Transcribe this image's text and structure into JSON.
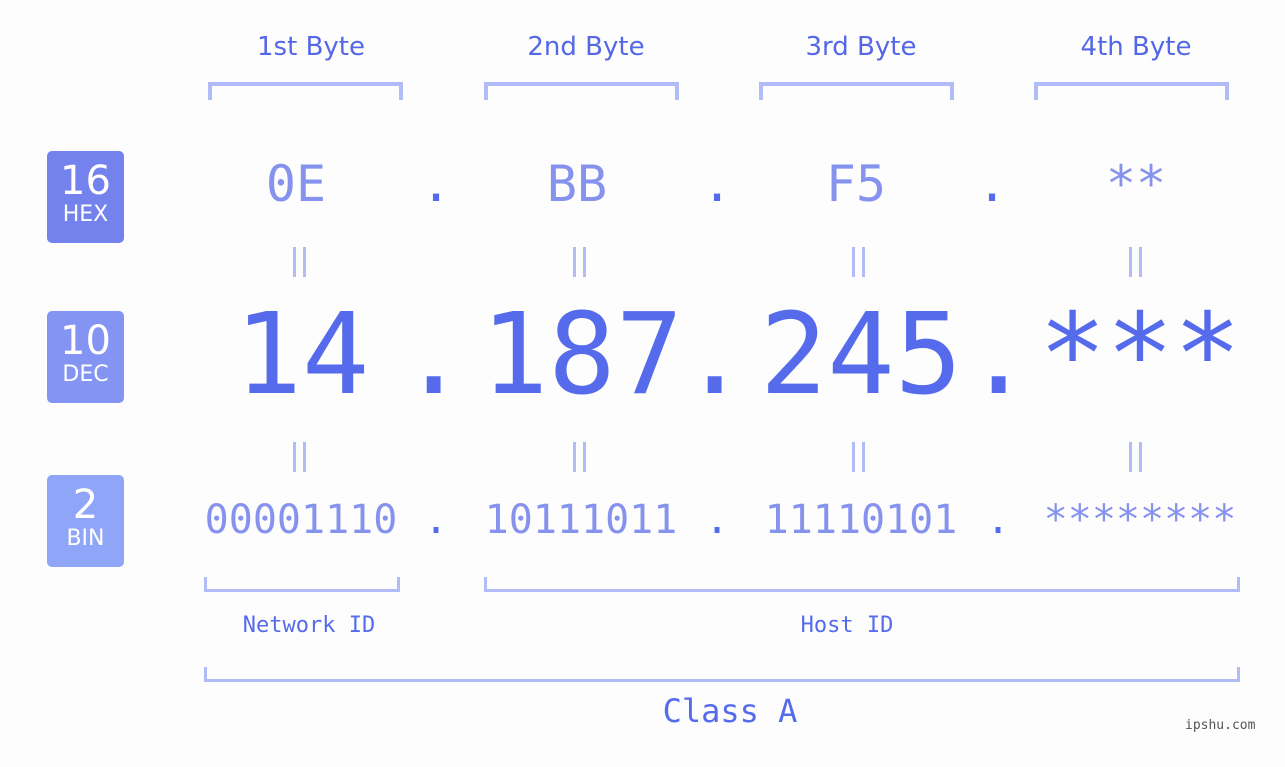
{
  "headers": [
    "1st Byte",
    "2nd Byte",
    "3rd Byte",
    "4th Byte"
  ],
  "badges": {
    "hex": {
      "num": "16",
      "label": "HEX",
      "color": "#7382ec"
    },
    "dec": {
      "num": "10",
      "label": "DEC",
      "color": "#8494f2"
    },
    "bin": {
      "num": "2",
      "label": "BIN",
      "color": "#8fa6f8"
    }
  },
  "hex": [
    "0E",
    "BB",
    "F5",
    "**"
  ],
  "dec": [
    "14",
    "187",
    "245",
    "***"
  ],
  "bin": [
    "00001110",
    "10111011",
    "11110101",
    "********"
  ],
  "separator": ".",
  "network_id_label": "Network ID",
  "host_id_label": "Host ID",
  "class_label": "Class A",
  "watermark": "ipshu.com",
  "colors": {
    "accent": "#566bec",
    "light": "#8592ee",
    "bracket": "#b1bbf8"
  }
}
